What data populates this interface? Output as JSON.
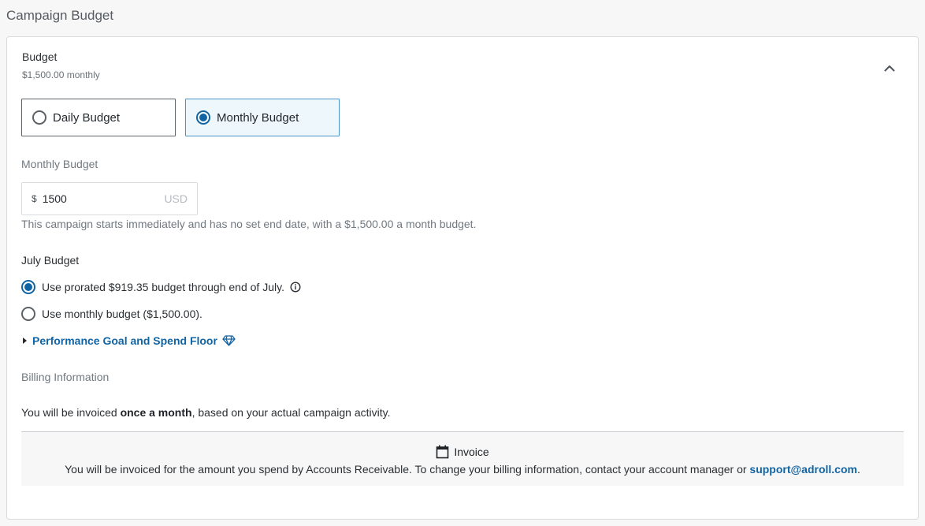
{
  "page": {
    "title": "Campaign Budget"
  },
  "budget": {
    "title": "Budget",
    "summary": "$1,500.00 monthly",
    "daily_label": "Daily Budget",
    "monthly_label": "Monthly Budget",
    "selected": "monthly"
  },
  "monthly_field": {
    "label": "Monthly Budget",
    "currency_symbol": "$",
    "value": "1500",
    "unit": "USD",
    "help": "This campaign starts immediately and has no set end date, with a $1,500.00 a month budget."
  },
  "july_budget": {
    "title": "July Budget",
    "option_prorated": "Use prorated $919.35 budget through end of July.",
    "option_monthly": "Use monthly budget ($1,500.00).",
    "selected": "prorated"
  },
  "performance": {
    "label": "Performance Goal and Spend Floor"
  },
  "billing": {
    "title": "Billing Information",
    "text_prefix": "You will be invoiced ",
    "text_bold": "once a month",
    "text_suffix": ", based on your actual campaign activity.",
    "invoice_heading": "Invoice",
    "invoice_text": "You will be invoiced for the amount you spend by Accounts Receivable. To change your billing information, contact your account manager or ",
    "support_email": "support@adroll.com",
    "invoice_end": "."
  },
  "colors": {
    "accent": "#1164a3",
    "selected_bg": "#eef7fc",
    "muted_text": "#717981"
  },
  "icons": {
    "collapse": "chevron-up-icon",
    "info": "info-icon",
    "caret": "caret-right-icon",
    "premium": "diamond-icon",
    "invoice": "calendar-icon"
  }
}
